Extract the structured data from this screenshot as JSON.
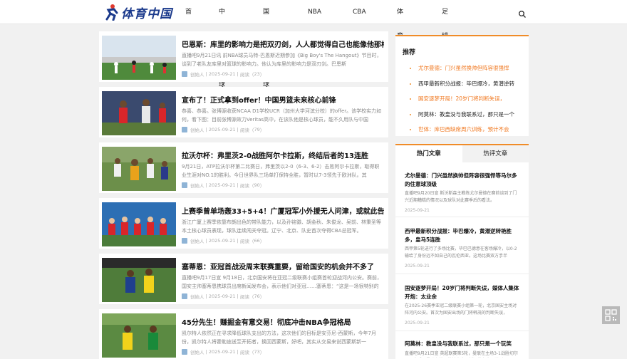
{
  "header": {
    "logo_text": "体育中国",
    "nav": [
      "首页",
      "中国足球",
      "国际足球",
      "NBA资讯",
      "CBA资讯",
      "体育赛事",
      "足球宝贝"
    ]
  },
  "colors": {
    "accent": "#f08c28",
    "brand": "#1b3a8c"
  },
  "articles": [
    {
      "title": "巴恩斯：库里的影响力是把双刃剑，人人都觉得自己也能像他那样",
      "summary": "直播吧9月21日讯 前NBA球员马特-巴恩斯近期参加《Big Boy's The Hangout》节目时，谈到了老队友库里对篮球的影响力。他认为库里的影响力是双刃剑。巴恩斯",
      "author": "创始人",
      "date": "2025-09-21",
      "reads_label": "阅读",
      "reads": "23"
    },
    {
      "title": "宣布了！正式拿到offer！中国男篮未来核心前锋",
      "summary": "恭喜、恭喜。张博源收获NCAA D1学校UCR（加州大学河滨分校）的offer。该学校实力如何，看下图：目前张博源效力Veritas高中，在该队他是核心球员，能不久用队与中国",
      "author": "创始人",
      "date": "2025-09-21",
      "reads_label": "阅读",
      "reads": "79"
    },
    {
      "title": "拉沃尔杯：弗里茨2-0战胜阿尔卡拉斯，终结后者的13连胜",
      "summary": "9月21日，ATP拉沃尔杯第二比赛日，弗里茨以2-0（6-3、6-2）击败阿尔卡拉斯，取得职业生涯对NO.1的胜利。今日世界队三场单打保持全胜，暂时以7-3领先于欧洲队。其",
      "author": "创始人",
      "date": "2025-09-21",
      "reads_label": "阅读",
      "reads": "90"
    },
    {
      "title": "上赛季曾单场轰33+5+4！广厦冠军小外援无人问津，或就此告别",
      "summary": "浙江广厦上赛季依靠布朗出色的带队能力，以及孙铭徽、胡金秋、朱俊龙、吴前、林秉圣等本土核心球员表现，球队连续闯关夺冠。辽宁、北京、队史首次夺得CBA总冠军。",
      "author": "创始人",
      "date": "2025-09-21",
      "reads_label": "阅读",
      "reads": "66"
    },
    {
      "title": "塞蒂恩：亚冠首战没周末联赛重要，留给国安的机会并不多了",
      "summary": "直播吧9月17日宣 9月18日，北京国安将在亚冠二级联赛小组赛首轮迎战河内公安。赛前，国安主帅塞蒂恩携球员出席新闻发布会，表示他们对亚冠……塞蒂恩：“这是一场很特别的比",
      "author": "创始人",
      "date": "2025-09-21",
      "reads_label": "阅读",
      "reads": "76"
    },
    {
      "title": "45分先生！赚掘金有意交易！彻底冲击NBA争冠格局",
      "summary": "凯尔特人依然正在寻求降低球队支出的方法，这次他们的目标是安芬尼-西蒙斯，今年7月份，凯尔特人将霍勒迪送至开拓者，换回西蒙斯，好吧，其实从交易来说西蒙斯新一",
      "author": "创始人",
      "date": "2025-09-21",
      "reads_label": "阅读",
      "reads": "73"
    }
  ],
  "recommend": {
    "title": "推荐",
    "items": [
      {
        "text": "尤尔曼德：门兴虽然换帅但阵容很强悍",
        "color": "orange"
      },
      {
        "text": "西甲最新积分战报：毕巴爆冷，黄潜逆转",
        "color": "dark"
      },
      {
        "text": "国安逐梦开局！20岁门将判断失误，",
        "color": "orange"
      },
      {
        "text": "阿莫林：教皇没与我联系过，那只是一个",
        "color": "dark"
      },
      {
        "text": "世体：库巴西缺席周六训练，预计不会",
        "color": "orange"
      }
    ]
  },
  "hot": {
    "tabs": [
      "热门文章",
      "热评文章"
    ],
    "items": [
      {
        "title": "尤尔曼德：门兴虽然换帅但阵容很强悍等马尔多的住意球顶级",
        "summary": "直播吧9月20日宣 斯沃斯森主教练尤尔曼德在赛前谈到了门兴近期糟糕的情况以及球队对此赛季后的看法。",
        "date": "2025-09-21"
      },
      {
        "title": "西甲最新积分战报：毕巴爆冷，黄潜逆转艳胜多，皇马5连胜",
        "summary": "西甲第5轮进行了多场比赛，毕巴巴德意在客场爆冷，以0-2输给了身份远不如自己的瓦伦西亚。这场比赛双方手半",
        "date": "2025-09-21"
      },
      {
        "title": "国安逐梦开局！20岁门将判断失误，媒体人集体开炮：太业余",
        "summary": "在2025-26赛季亚冠二级联赛小组第一轮，北京国安主场对阵河内公安。首次为国安出场的门将韩茂的判断失误，",
        "date": "2025-09-21"
      },
      {
        "title": "阿莫林：教皇没与我联系过，那只是一个玩笑",
        "summary": "直播吧9月21日宣 英超联赛第5轮，曼联在主场3-1战胜切尔西。赛后，曼联主帅阿莫林出席了新闻发布会，谈到",
        "date": "2025-09-21"
      }
    ]
  }
}
